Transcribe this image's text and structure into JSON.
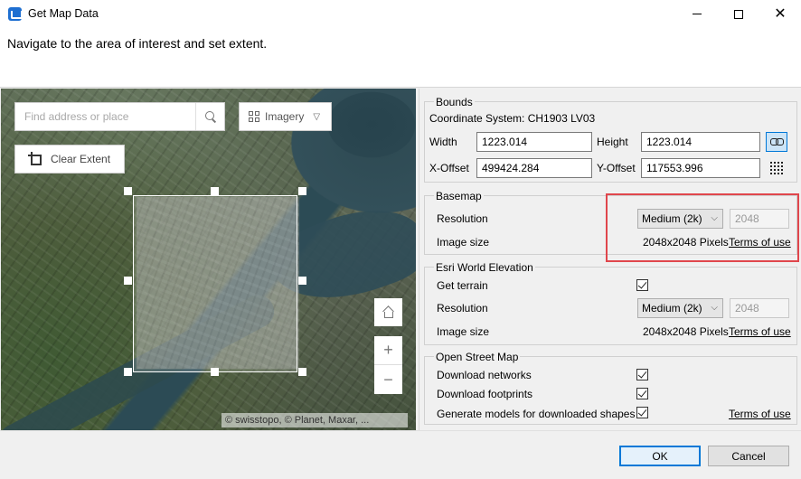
{
  "window": {
    "title": "Get Map Data",
    "minimize_icon": "minimize-icon",
    "maximize_icon": "maximize-icon",
    "close_icon": "close-icon"
  },
  "header": {
    "instruction": "Navigate to the area of interest and set extent."
  },
  "map": {
    "search": {
      "placeholder": "Find address or place",
      "value": ""
    },
    "basemap_toggle": {
      "label": "Imagery"
    },
    "clear_extent": {
      "label": "Clear Extent"
    },
    "zoom_in": "+",
    "zoom_out": "−",
    "attribution": "© swisstopo, © Planet, Maxar, ..."
  },
  "bounds": {
    "legend": "Bounds",
    "coordinate_system": "Coordinate System: CH1903 LV03",
    "width_label": "Width",
    "width_value": "1223.014",
    "height_label": "Height",
    "height_value": "1223.014",
    "x_offset_label": "X-Offset",
    "x_offset_value": "499424.284",
    "y_offset_label": "Y-Offset",
    "y_offset_value": "117553.996"
  },
  "basemap": {
    "legend": "Basemap",
    "resolution_label": "Resolution",
    "resolution_value": "Medium (2k)",
    "resolution_pixels": "2048",
    "image_size_label": "Image size",
    "image_size_value": "2048x2048 Pixels",
    "terms_link": "Terms of use"
  },
  "elevation": {
    "legend": "Esri World Elevation",
    "get_terrain_label": "Get terrain",
    "get_terrain_checked": true,
    "resolution_label": "Resolution",
    "resolution_value": "Medium (2k)",
    "resolution_pixels": "2048",
    "image_size_label": "Image size",
    "image_size_value": "2048x2048 Pixels",
    "terms_link": "Terms of use"
  },
  "osm": {
    "legend": "Open Street Map",
    "download_networks_label": "Download networks",
    "download_networks_checked": true,
    "download_footprints_label": "Download footprints",
    "download_footprints_checked": true,
    "generate_models_label": "Generate models for downloaded shapes",
    "generate_models_checked": true,
    "terms_link": "Terms of use"
  },
  "footer": {
    "ok_label": "OK",
    "cancel_label": "Cancel"
  },
  "colors": {
    "accent": "#0078d7",
    "highlight": "#e0464c"
  }
}
